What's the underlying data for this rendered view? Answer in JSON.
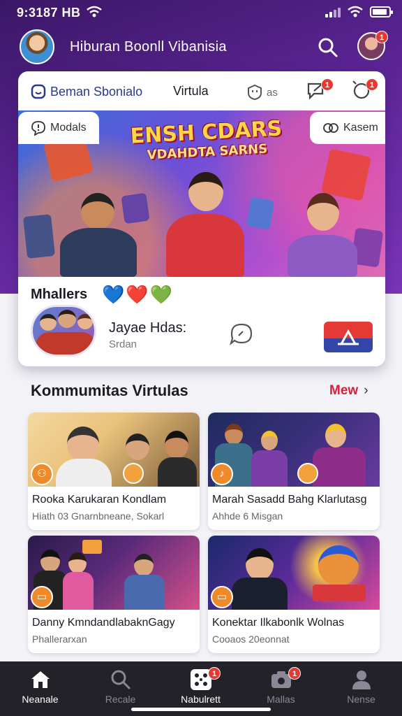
{
  "status_bar": {
    "time": "9:3187 HB"
  },
  "header": {
    "title": "Hiburan Boonll Vibanisia",
    "profile_badge": "1"
  },
  "tabs": {
    "tab1": "Beman Sbonialo",
    "tab2": "Virtula",
    "tab3_suffix": "as",
    "notif_badge_1": "1",
    "notif_badge_2": "1"
  },
  "chips": {
    "left": "Modals",
    "right": "Kasem"
  },
  "banner": {
    "line1": "ENSH CDARS",
    "line2": "VDAHDTA SARNS"
  },
  "members": {
    "label": "Mhallers",
    "hearts": [
      "💙",
      "❤️",
      "💚"
    ],
    "group_name": "Jayae Hdas:",
    "group_sub": "Srdan"
  },
  "section": {
    "title": "Kommumitas Virtulas",
    "more": "Mew"
  },
  "tiles": [
    {
      "title": "Rooka Karukaran Kondlam",
      "sub": "Hiath 03 Gnarnbneane, Sokarl"
    },
    {
      "title": "Marah Sasadd Bahg Klarlutasg",
      "sub": "Ahhde 6 Misgan"
    },
    {
      "title": "Danny KmndandlabaknGagy",
      "sub": "Phallerarxan"
    },
    {
      "title": "Konektar Ilkabonlk Wolnas",
      "sub": "Cooaos 20eonnat"
    }
  ],
  "nav": [
    {
      "label": "Neanale",
      "active": false
    },
    {
      "label": "Recale",
      "active": false
    },
    {
      "label": "Nabulrett",
      "active": true,
      "badge": "1"
    },
    {
      "label": "Mallas",
      "active": false,
      "badge": "1"
    },
    {
      "label": "Nense",
      "active": false
    }
  ],
  "colors": {
    "brand_purple": "#5a2493",
    "accent_red": "#e53935",
    "link_red": "#d6203b"
  }
}
